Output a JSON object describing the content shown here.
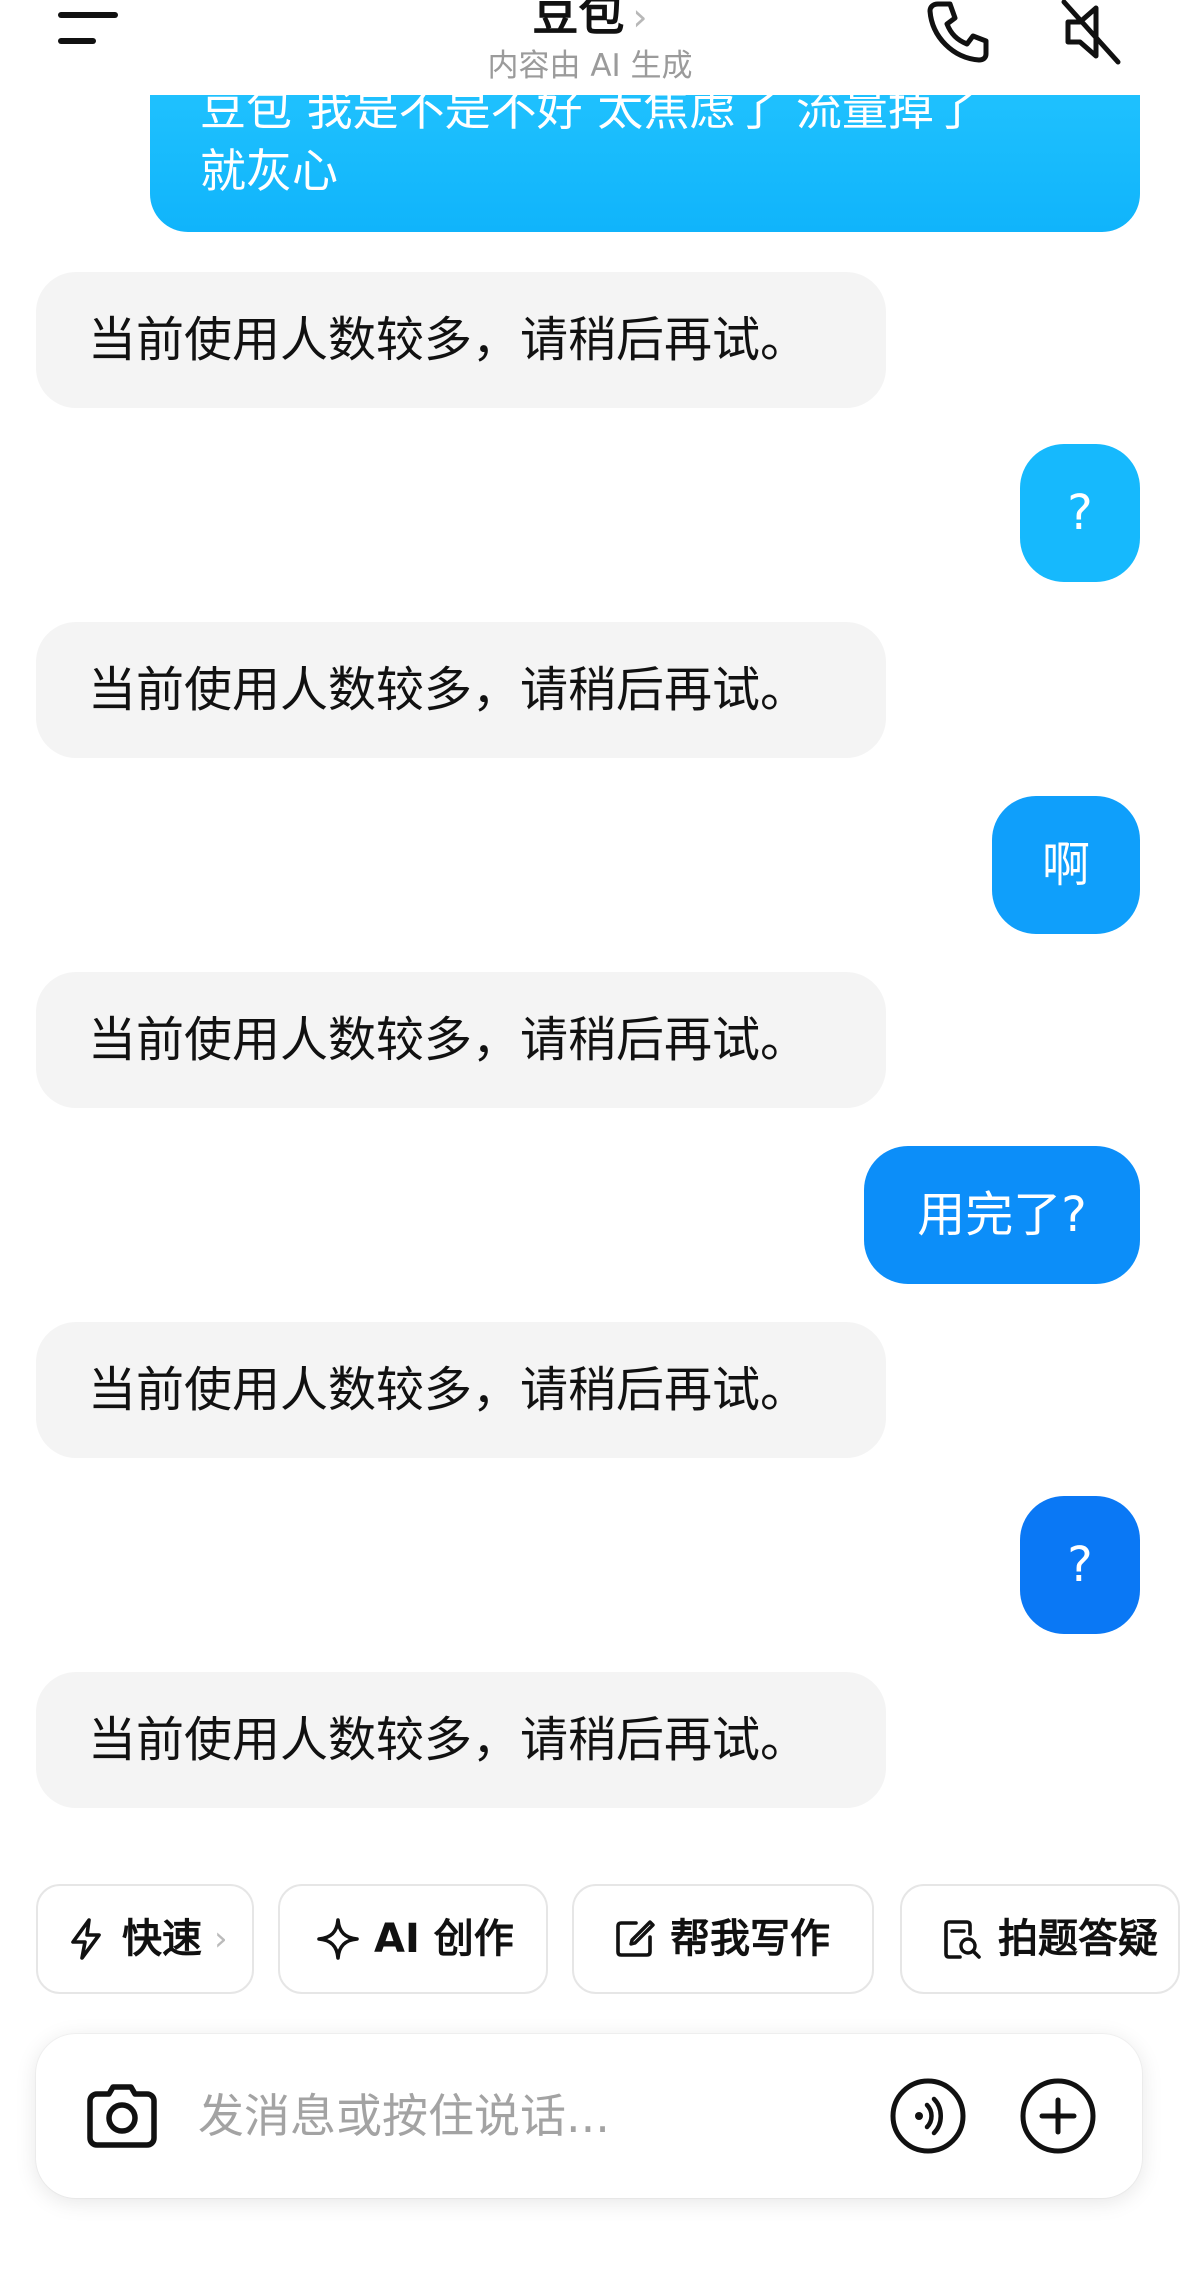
{
  "header": {
    "title": "豆包",
    "title_chevron": "›",
    "subtitle": "内容由 AI 生成",
    "icons": [
      "menu-icon",
      "phone-icon",
      "speaker-mute-icon"
    ]
  },
  "messages": {
    "user_top": {
      "line1": "豆包 我是不是不好 太焦虑了 流量掉了",
      "line2": "就灰心"
    },
    "bot_1": "当前使用人数较多，请稍后再试。",
    "user_1": "?",
    "bot_2": "当前使用人数较多，请稍后再试。",
    "user_2": "啊",
    "bot_3": "当前使用人数较多，请稍后再试。",
    "user_3": "用完了?",
    "bot_4": "当前使用人数较多，请稍后再试。",
    "user_4": "?",
    "bot_5": "当前使用人数较多，请稍后再试。"
  },
  "quick_actions": [
    {
      "label": "快速",
      "chevron": "›",
      "icon": "lightning-icon"
    },
    {
      "label": "AI 创作",
      "icon": "sparkle-icon"
    },
    {
      "label": "帮我写作",
      "icon": "edit-icon"
    },
    {
      "label": "拍题答疑",
      "icon": "search-document-icon"
    }
  ],
  "input": {
    "placeholder": "发消息或按住说话...",
    "icons": [
      "camera-icon",
      "voice-icon",
      "plus-icon"
    ]
  },
  "colors": {
    "user_bubble_light": "#16B9FD",
    "user_bubble_mid": "#0C9CFB",
    "user_bubble_dark": "#0A78F5",
    "bot_bubble": "#F4F4F4",
    "subtitle": "#9B9B9B",
    "placeholder": "#A3A3A3"
  }
}
